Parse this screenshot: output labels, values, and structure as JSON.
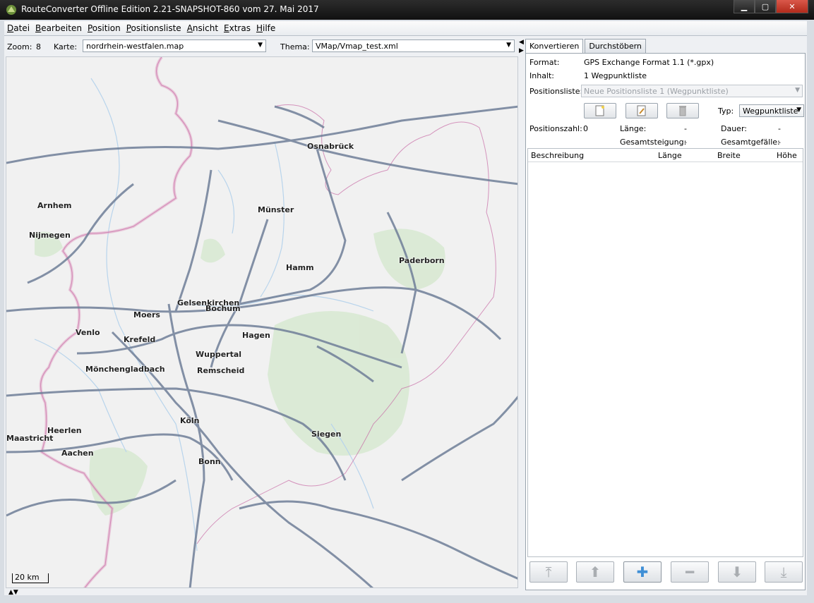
{
  "window": {
    "title": "RouteConverter Offline Edition 2.21-SNAPSHOT-860 vom 27. Mai 2017"
  },
  "menu": [
    {
      "first": "D",
      "rest": "atei"
    },
    {
      "first": "B",
      "rest": "earbeiten"
    },
    {
      "first": "P",
      "rest": "osition"
    },
    {
      "first": "P",
      "rest": "ositionsliste"
    },
    {
      "first": "A",
      "rest": "nsicht"
    },
    {
      "first": "E",
      "rest": "xtras"
    },
    {
      "first": "H",
      "rest": "ilfe"
    }
  ],
  "map_toolbar": {
    "zoom_label": "Zoom:",
    "zoom_value": "8",
    "karte_label": "Karte:",
    "karte_value": "nordrhein-westfalen.map",
    "thema_label": "Thema:",
    "thema_value": "VMap/Vmap_test.xml"
  },
  "map": {
    "scale_label": "20 km",
    "cities": [
      "Osnabrück",
      "Arnhem",
      "Nijmegen",
      "Münster",
      "Paderborn",
      "Hamm",
      "Gelsenkirchen",
      "Bochum",
      "Moers",
      "Venlo",
      "Krefeld",
      "Hagen",
      "Wuppertal",
      "Mönchengladbach",
      "Remscheid",
      "Köln",
      "Heerlen",
      "Maastricht",
      "Aachen",
      "Siegen",
      "Bonn"
    ],
    "colors": {
      "road": "#6f7f98",
      "border": "#e0a4c4",
      "water": "#b8d4ec",
      "forest": "#d6e8cf"
    }
  },
  "panel": {
    "tabs": [
      "Konvertieren",
      "Durchstöbern"
    ],
    "format_label": "Format:",
    "format_value": "GPS Exchange Format 1.1 (*.gpx)",
    "inhalt_label": "Inhalt:",
    "inhalt_value": "1 Wegpunktliste",
    "positionsliste_label": "Positionsliste:",
    "positionsliste_value": "Neue Positionsliste 1 (Wegpunktliste)",
    "typ_label": "Typ:",
    "typ_value": "Wegpunktliste",
    "positionszahl_label": "Positionszahl:",
    "positionszahl_value": "0",
    "laenge_label": "Länge:",
    "laenge_value": "-",
    "dauer_label": "Dauer:",
    "dauer_value": "-",
    "steigung_label": "Gesamtsteigung:",
    "steigung_value": "-",
    "gefaelle_label": "Gesamtgefälle:",
    "gefaelle_value": "-",
    "columns": [
      "Beschreibung",
      "Länge",
      "Breite",
      "Höhe"
    ]
  }
}
